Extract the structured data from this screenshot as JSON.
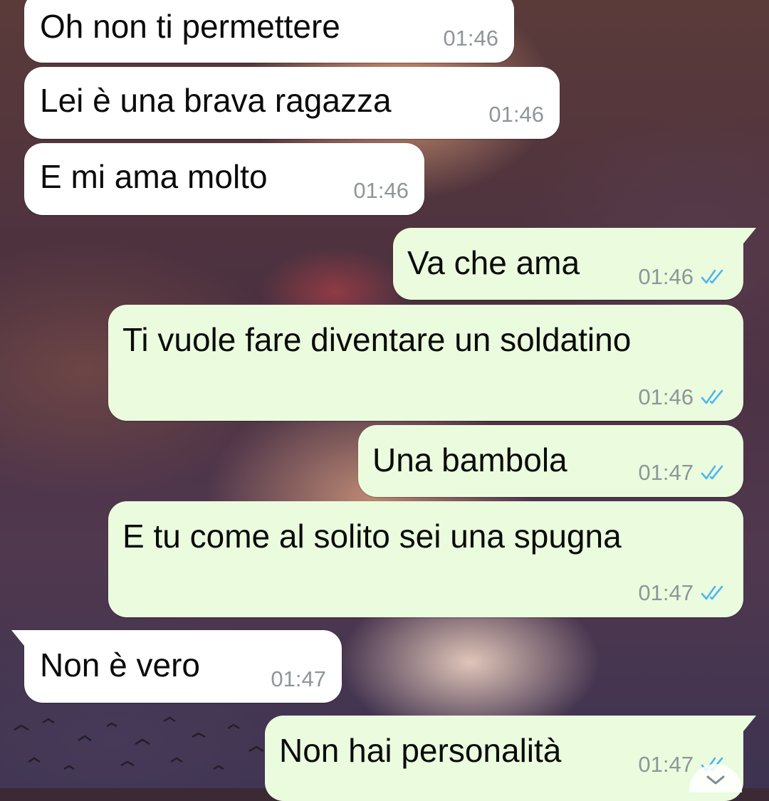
{
  "chat": {
    "messages": [
      {
        "direction": "incoming",
        "text": "Oh non ti permettere",
        "time": "01:46"
      },
      {
        "direction": "incoming",
        "text": "Lei è una brava ragazza",
        "time": "01:46"
      },
      {
        "direction": "incoming",
        "text": "E mi ama molto",
        "time": "01:46"
      },
      {
        "direction": "outgoing",
        "text": "Va che ama",
        "time": "01:46",
        "status": "read"
      },
      {
        "direction": "outgoing",
        "text": "Ti vuole fare diventare un soldatino",
        "time": "01:46",
        "status": "read"
      },
      {
        "direction": "outgoing",
        "text": "Una bambola",
        "time": "01:47",
        "status": "read"
      },
      {
        "direction": "outgoing",
        "text": "E tu come al solito sei una spugna",
        "time": "01:47",
        "status": "read"
      },
      {
        "direction": "incoming",
        "text": "Non è vero",
        "time": "01:47"
      },
      {
        "direction": "outgoing",
        "text": "Non hai personalità",
        "time": "01:47",
        "status": "read"
      }
    ]
  },
  "icons": {
    "read_receipt": "double-check-icon",
    "scroll_down": "chevron-down-icon"
  },
  "colors": {
    "incoming_bubble": "#ffffff",
    "outgoing_bubble": "#ebfcde",
    "read_tick": "#4fb6ec",
    "timestamp": "#8e9698"
  }
}
